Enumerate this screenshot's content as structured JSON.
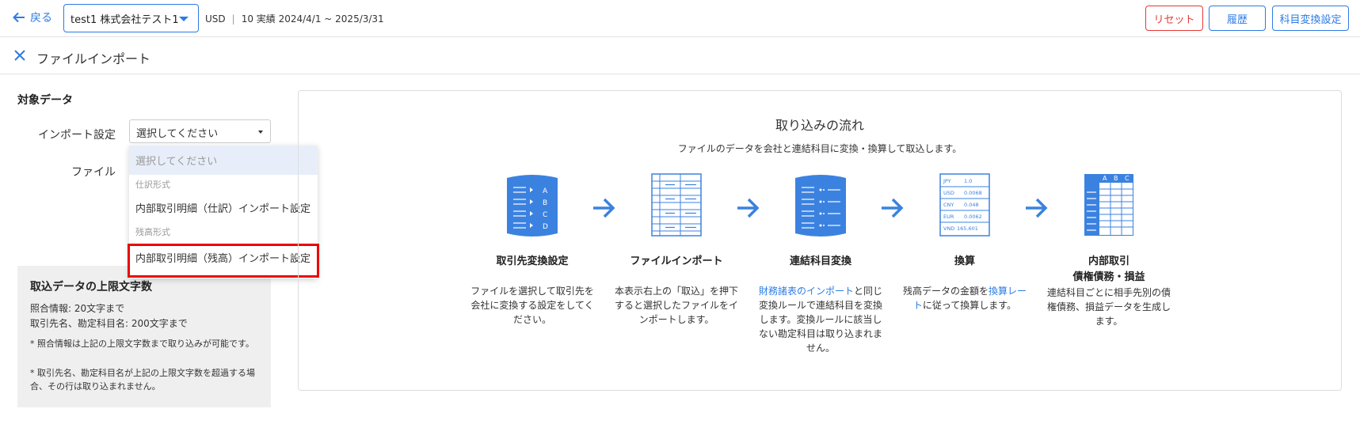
{
  "header": {
    "back_label": "戻る",
    "company": "test1 株式会社テスト1",
    "currency": "USD",
    "period": "10 実績 2024/4/1 ~ 2025/3/31",
    "reset_label": "リセット",
    "history_label": "履歴",
    "convert_label": "科目変換設定"
  },
  "subheader": {
    "title": "ファイルインポート"
  },
  "form": {
    "section_title": "対象データ",
    "import_setting_label": "インポート設定",
    "file_label": "ファイル",
    "select_value": "選択してください"
  },
  "dropdown": {
    "placeholder": "選択してください",
    "group1": "仕訳形式",
    "option1": "内部取引明細（仕訳）インポート設定",
    "group2": "残高形式",
    "option2": "内部取引明細（残高）インポート設定"
  },
  "limits": {
    "title": "取込データの上限文字数",
    "line1": "照合情報: 20文字まで",
    "line2": "取引先名、勘定科目名: 200文字まで",
    "note1": "* 照合情報は上記の上限文字数まで取り込みが可能です。",
    "note2": "* 取引先名、勘定科目名が上記の上限文字数を超過する場合、その行は取り込まれません。"
  },
  "flow": {
    "title": "取り込みの流れ",
    "description": "ファイルのデータを会社と連結科目に変換・換算して取込します。",
    "steps": [
      {
        "title": "取引先変換設定",
        "text": "ファイルを選択して取引先を会社に変換する設定をしてください。",
        "icon": "database-partner-icon"
      },
      {
        "title": "ファイルインポート",
        "text": "本表示右上の「取込」を押下すると選択したファイルをインポートします。",
        "icon": "file-table-icon"
      },
      {
        "title": "連結科目変換",
        "link": "財務諸表のインポート",
        "text": "と同じ変換ルールで連結科目を変換します。変換ルールに該当しない勘定科目は取り込まれません。",
        "icon": "database-list-icon"
      },
      {
        "title": "換算",
        "text_pre": "残高データの金額を",
        "link": "換算レート",
        "text": "に従って換算します。",
        "icon": "exchange-rate-table-icon"
      },
      {
        "title_line1": "内部取引",
        "title_line2": "債権債務・損益",
        "text": "連結科目ごとに相手先別の債権債務、損益データを生成します。",
        "icon": "spreadsheet-icon"
      }
    ],
    "rates": [
      {
        "code": "JPY",
        "rate": "1.0"
      },
      {
        "code": "USD",
        "rate": "0.0068"
      },
      {
        "code": "CNY",
        "rate": "0.048"
      },
      {
        "code": "EUR",
        "rate": "0.0062"
      },
      {
        "code": "VND",
        "rate": "165.601"
      }
    ],
    "partner_letters": [
      "A",
      "B",
      "C",
      "D"
    ],
    "sheet_columns": [
      "A",
      "B",
      "C"
    ]
  },
  "colors": {
    "accent": "#2c7be5",
    "danger": "#e53935",
    "icon_blue": "#3b82e0"
  }
}
